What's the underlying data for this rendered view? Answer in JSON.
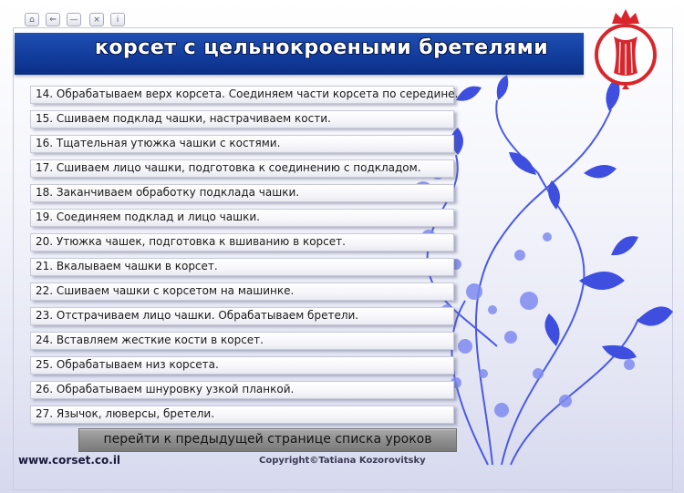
{
  "nav": {
    "home_glyph": "⌂",
    "back_glyph": "⇐",
    "minimize_glyph": "—",
    "close_glyph": "×",
    "info_glyph": "i"
  },
  "banner": {
    "title": "корсет с цельнокроеными бретелями"
  },
  "lessons": [
    "14. Обрабатываем верх корсета. Соединяем части корсета по середине.",
    "15. Сшиваем подклад чашки, настрачиваем кости.",
    "16. Тщательная утюжка чашки с костями.",
    "17. Сшиваем лицо чашки, подготовка к соединению с подкладом.",
    "18. Заканчиваем обработку подклада чашки.",
    "19. Соединяем подклад и лицо чашки.",
    "20. Утюжка чашек, подготовка к вшиванию в корсет.",
    "21. Вкалываем чашки в корсет.",
    "22. Сшиваем чашки с корсетом на машинке.",
    "23. Отстрачиваем лицо чашки. Обрабатываем бретели.",
    "24. Вставляем жесткие кости в корсет.",
    "25. Обрабатываем низ корсета.",
    "26. Обрабатываем шнуровку узкой планкой.",
    "27. Язычок, люверсы, бретели."
  ],
  "prev_button": {
    "label": "перейти к предыдущей странице списка уроков"
  },
  "footer": {
    "site": "www.corset.co.il",
    "copyright": "Copyright©Tatiana Kozorovitsky"
  },
  "colors": {
    "banner": "#123d9d",
    "logo_red": "#d8262c",
    "decor_blue": "#3e4fe0"
  },
  "icons": {
    "logo": "corset-crown-logo-icon",
    "decor": "blue-leaf-branch-icon"
  }
}
